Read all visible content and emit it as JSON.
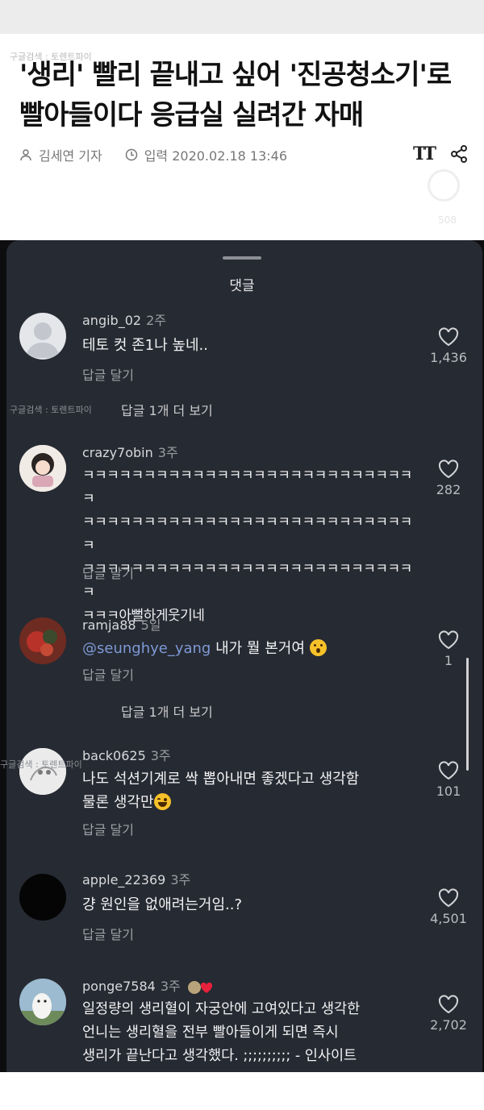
{
  "watermark": "구글검색 : 토렌트파이",
  "article": {
    "headline": "'생리' 빨리 끝내고 싶어 '진공청소기'로 빨아들이다 응급실 실려간 자매",
    "author": "김세연 기자",
    "date": "입력 2020.02.18 13:46",
    "ghost_count": "508"
  },
  "sheet": {
    "title": "댓글"
  },
  "labels": {
    "reply": "답글 달기",
    "more_replies": "답글 1개 더 보기"
  },
  "comments": [
    {
      "user": "angib_02",
      "age": "2주",
      "text": "테토 컷 존1나 높네..",
      "likes": "1,436"
    },
    {
      "user": "crazy7obin",
      "age": "3주",
      "text": "ㅋㅋㅋㅋㅋㅋㅋㅋㅋㅋㅋㅋㅋㅋㅋㅋㅋㅋㅋㅋㅋㅋㅋㅋㅋㅋㅋㅋ\nㅋㅋㅋㅋㅋㅋㅋㅋㅋㅋㅋㅋㅋㅋㅋㅋㅋㅋㅋㅋㅋㅋㅋㅋㅋㅋㅋㅋ\nㅋㅋㅋㅋㅋㅋㅋㅋㅋㅋㅋㅋㅋㅋㅋㅋㅋㅋㅋㅋㅋㅋㅋㅋㅋㅋㅋㅋ\nㅋㅋㅋ아뻘하게웃기네",
      "likes": "282"
    },
    {
      "user": "ramja88",
      "age": "5일",
      "mention": "@seunghye_yang",
      "text": " 내가 뭘 본거여",
      "likes": "1"
    },
    {
      "user": "back0625",
      "age": "3주",
      "text": "나도 석션기계로 싹 뽑아내면 좋겠다고 생각함\n물론 생각만",
      "likes": "101"
    },
    {
      "user": "apple_22369",
      "age": "3주",
      "text": "걍 원인을 없애려는거임..?",
      "likes": "4,501"
    },
    {
      "user": "ponge7584",
      "age": "3주",
      "text": "일정량의 생리혈이 자궁안에 고여있다고 생각한\n언니는 생리혈을 전부 빨아들이게 되면 즉시\n생리가 끝난다고 생각했다. ;;;;;;;;;; - 인사이트",
      "likes": "2,702"
    }
  ],
  "colors": {
    "sheet_bg": "#262a32",
    "mention": "#7e99d6",
    "emoji": "#f7c12a"
  },
  "icons": [
    "person-icon",
    "clock-icon",
    "text-size-icon",
    "share-icon",
    "heart-icon",
    "heart-badge-icon"
  ]
}
